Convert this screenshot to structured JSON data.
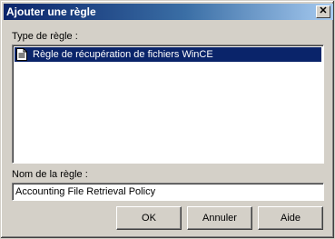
{
  "window": {
    "title": "Ajouter une règle",
    "close_glyph": "✕"
  },
  "rule_type": {
    "label": "Type de règle :",
    "items": [
      {
        "label": "Règle de récupération de fichiers WinCE",
        "icon": "document-icon",
        "selected": true
      }
    ]
  },
  "rule_name": {
    "label": "Nom de la règle :",
    "value": "Accounting File Retrieval Policy"
  },
  "buttons": {
    "ok": "OK",
    "cancel": "Annuler",
    "help": "Aide"
  },
  "colors": {
    "titlebar_start": "#0a246a",
    "selection": "#0a246a",
    "face": "#d4d0c8"
  }
}
